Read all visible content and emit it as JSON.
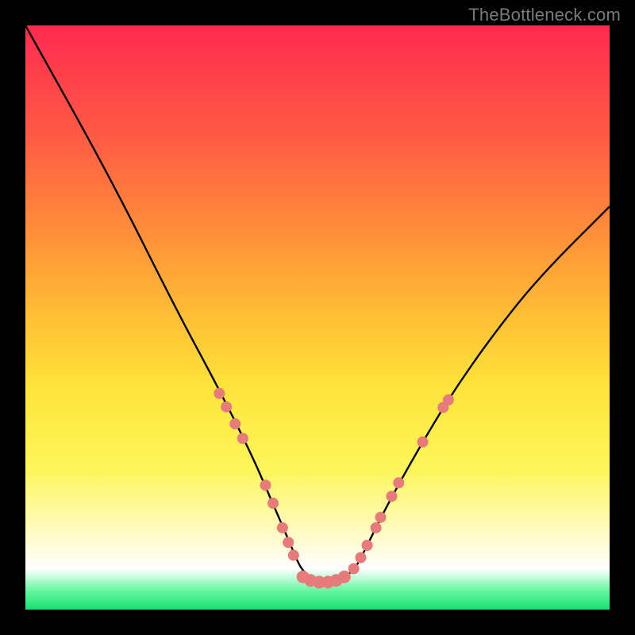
{
  "watermark": "TheBottleneck.com",
  "chart_data": {
    "type": "line",
    "title": "",
    "xlabel": "",
    "ylabel": "",
    "xlim": [
      0,
      100
    ],
    "ylim": [
      0,
      100
    ],
    "series": [
      {
        "name": "curve",
        "x": [
          0,
          14.5,
          26,
          33,
          38.5,
          42,
          45,
          48,
          54,
          56.5,
          58.5,
          62,
          67,
          73,
          80,
          88,
          100
        ],
        "y": [
          100,
          74,
          51,
          38,
          27,
          19,
          12,
          5,
          5,
          7,
          11,
          18,
          27,
          37,
          47,
          57,
          69
        ]
      }
    ],
    "markers": {
      "left_branch": [
        {
          "x": 33.2,
          "y": 37.0
        },
        {
          "x": 34.4,
          "y": 34.7
        },
        {
          "x": 35.9,
          "y": 31.8
        },
        {
          "x": 37.2,
          "y": 29.3
        },
        {
          "x": 41.1,
          "y": 21.3
        },
        {
          "x": 42.4,
          "y": 18.2
        },
        {
          "x": 44.0,
          "y": 14.0
        },
        {
          "x": 45.0,
          "y": 11.5
        },
        {
          "x": 45.9,
          "y": 9.3
        }
      ],
      "bottom_flat": [
        {
          "x": 47.5,
          "y": 5.6
        },
        {
          "x": 48.8,
          "y": 5.0
        },
        {
          "x": 50.3,
          "y": 4.7
        },
        {
          "x": 51.8,
          "y": 4.7
        },
        {
          "x": 53.2,
          "y": 5.0
        },
        {
          "x": 54.6,
          "y": 5.6
        }
      ],
      "right_branch": [
        {
          "x": 56.2,
          "y": 7.0
        },
        {
          "x": 57.4,
          "y": 8.9
        },
        {
          "x": 58.5,
          "y": 11.0
        },
        {
          "x": 60.0,
          "y": 14.0
        },
        {
          "x": 60.8,
          "y": 15.8
        },
        {
          "x": 62.7,
          "y": 19.4
        },
        {
          "x": 63.9,
          "y": 21.7
        },
        {
          "x": 68.0,
          "y": 28.7
        },
        {
          "x": 71.5,
          "y": 34.6
        },
        {
          "x": 72.4,
          "y": 35.9
        }
      ]
    },
    "background_bands": [
      {
        "name": "red",
        "from": 100,
        "to": 50,
        "color_top": "#ff2a4f",
        "color_bottom": "#ffbf34"
      },
      {
        "name": "yellow",
        "from": 50,
        "to": 12,
        "color_top": "#ffbf34",
        "color_bottom": "#fffccf"
      },
      {
        "name": "white",
        "from": 12,
        "to": 5,
        "color_top": "#fffccf",
        "color_bottom": "#ffffff"
      },
      {
        "name": "green",
        "from": 5,
        "to": 0,
        "color_top": "#5df79b",
        "color_bottom": "#19e06e"
      }
    ]
  }
}
